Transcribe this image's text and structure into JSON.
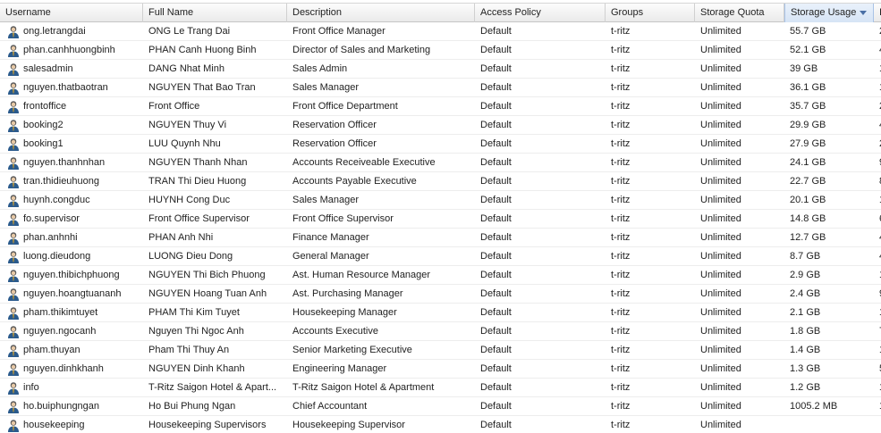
{
  "columns": {
    "username": "Username",
    "full_name": "Full Name",
    "description": "Description",
    "access_policy": "Access Policy",
    "groups": "Groups",
    "storage_quota": "Storage Quota",
    "storage_usage": "Storage Usage",
    "next": "I"
  },
  "sort": {
    "column": "storage_usage",
    "direction": "descending"
  },
  "icons": {
    "row_icon": "user-icon",
    "sort_icon": "sort-descending-icon"
  },
  "colors": {
    "header_bg": "#eaeaea",
    "sorted_header_bg": "#d6e4f5",
    "icon_head": "#5a5a5a",
    "icon_body": "#2a5a8c"
  },
  "rows": [
    {
      "username": "ong.letrangdai",
      "full_name": "ONG Le Trang Dai",
      "description": "Front Office Manager",
      "access_policy": "Default",
      "groups": "t-ritz",
      "storage_quota": "Unlimited",
      "storage_usage": "55.7 GB",
      "next": "2"
    },
    {
      "username": "phan.canhhuongbinh",
      "full_name": "PHAN Canh Huong Binh",
      "description": "Director of Sales and Marketing",
      "access_policy": "Default",
      "groups": "t-ritz",
      "storage_quota": "Unlimited",
      "storage_usage": "52.1 GB",
      "next": "4"
    },
    {
      "username": "salesadmin",
      "full_name": "DANG Nhat Minh",
      "description": "Sales Admin",
      "access_policy": "Default",
      "groups": "t-ritz",
      "storage_quota": "Unlimited",
      "storage_usage": "39 GB",
      "next": "1"
    },
    {
      "username": "nguyen.thatbaotran",
      "full_name": "NGUYEN That Bao Tran",
      "description": "Sales Manager",
      "access_policy": "Default",
      "groups": "t-ritz",
      "storage_quota": "Unlimited",
      "storage_usage": "36.1 GB",
      "next": "1"
    },
    {
      "username": "frontoffice",
      "full_name": "Front Office",
      "description": "Front Office Department",
      "access_policy": "Default",
      "groups": "t-ritz",
      "storage_quota": "Unlimited",
      "storage_usage": "35.7 GB",
      "next": "2"
    },
    {
      "username": "booking2",
      "full_name": "NGUYEN Thuy Vi",
      "description": "Reservation Officer",
      "access_policy": "Default",
      "groups": "t-ritz",
      "storage_quota": "Unlimited",
      "storage_usage": "29.9 GB",
      "next": "4"
    },
    {
      "username": "booking1",
      "full_name": "LUU Quynh Nhu",
      "description": "Reservation Officer",
      "access_policy": "Default",
      "groups": "t-ritz",
      "storage_quota": "Unlimited",
      "storage_usage": "27.9 GB",
      "next": "2"
    },
    {
      "username": "nguyen.thanhnhan",
      "full_name": "NGUYEN Thanh Nhan",
      "description": "Accounts Receiveable Executive",
      "access_policy": "Default",
      "groups": "t-ritz",
      "storage_quota": "Unlimited",
      "storage_usage": "24.1 GB",
      "next": "9"
    },
    {
      "username": "tran.thidieuhuong",
      "full_name": "TRAN Thi Dieu Huong",
      "description": "Accounts Payable Executive",
      "access_policy": "Default",
      "groups": "t-ritz",
      "storage_quota": "Unlimited",
      "storage_usage": "22.7 GB",
      "next": "8"
    },
    {
      "username": "huynh.congduc",
      "full_name": "HUYNH Cong Duc",
      "description": "Sales Manager",
      "access_policy": "Default",
      "groups": "t-ritz",
      "storage_quota": "Unlimited",
      "storage_usage": "20.1 GB",
      "next": "1"
    },
    {
      "username": "fo.supervisor",
      "full_name": "Front Office Supervisor",
      "description": "Front Office Supervisor",
      "access_policy": "Default",
      "groups": "t-ritz",
      "storage_quota": "Unlimited",
      "storage_usage": "14.8 GB",
      "next": "6"
    },
    {
      "username": "phan.anhnhi",
      "full_name": "PHAN Anh Nhi",
      "description": "Finance Manager",
      "access_policy": "Default",
      "groups": "t-ritz",
      "storage_quota": "Unlimited",
      "storage_usage": "12.7 GB",
      "next": "4"
    },
    {
      "username": "luong.dieudong",
      "full_name": "LUONG Dieu Dong",
      "description": "General Manager",
      "access_policy": "Default",
      "groups": "t-ritz",
      "storage_quota": "Unlimited",
      "storage_usage": "8.7 GB",
      "next": "4"
    },
    {
      "username": "nguyen.thibichphuong",
      "full_name": "NGUYEN Thi Bich Phuong",
      "description": "Ast. Human Resource Manager",
      "access_policy": "Default",
      "groups": "t-ritz",
      "storage_quota": "Unlimited",
      "storage_usage": "2.9 GB",
      "next": "1"
    },
    {
      "username": "nguyen.hoangtuananh",
      "full_name": "NGUYEN Hoang Tuan Anh",
      "description": "Ast. Purchasing Manager",
      "access_policy": "Default",
      "groups": "t-ritz",
      "storage_quota": "Unlimited",
      "storage_usage": "2.4 GB",
      "next": "9"
    },
    {
      "username": "pham.thikimtuyet",
      "full_name": "PHAM Thi Kim Tuyet",
      "description": "Housekeeping Manager",
      "access_policy": "Default",
      "groups": "t-ritz",
      "storage_quota": "Unlimited",
      "storage_usage": "2.1 GB",
      "next": "1"
    },
    {
      "username": "nguyen.ngocanh",
      "full_name": "Nguyen Thi Ngoc Anh",
      "description": "Accounts Executive",
      "access_policy": "Default",
      "groups": "t-ritz",
      "storage_quota": "Unlimited",
      "storage_usage": "1.8 GB",
      "next": "7"
    },
    {
      "username": "pham.thuyan",
      "full_name": "Pham Thi Thuy An",
      "description": "Senior Marketing Executive",
      "access_policy": "Default",
      "groups": "t-ritz",
      "storage_quota": "Unlimited",
      "storage_usage": "1.4 GB",
      "next": "1"
    },
    {
      "username": "nguyen.dinhkhanh",
      "full_name": "NGUYEN Dinh Khanh",
      "description": "Engineering Manager",
      "access_policy": "Default",
      "groups": "t-ritz",
      "storage_quota": "Unlimited",
      "storage_usage": "1.3 GB",
      "next": "5"
    },
    {
      "username": "info",
      "full_name": "T-Ritz Saigon Hotel & Apart...",
      "description": "T-Ritz Saigon Hotel & Apartment",
      "access_policy": "Default",
      "groups": "t-ritz",
      "storage_quota": "Unlimited",
      "storage_usage": "1.2 GB",
      "next": "1"
    },
    {
      "username": "ho.buiphungngan",
      "full_name": "Ho Bui Phung Ngan",
      "description": "Chief Accountant",
      "access_policy": "Default",
      "groups": "t-ritz",
      "storage_quota": "Unlimited",
      "storage_usage": "1005.2 MB",
      "next": "1"
    },
    {
      "username": "housekeeping",
      "full_name": "Housekeeping Supervisors",
      "description": "Housekeeping Supervisor",
      "access_policy": "Default",
      "groups": "t-ritz",
      "storage_quota": "Unlimited",
      "storage_usage": "",
      "next": ""
    }
  ]
}
